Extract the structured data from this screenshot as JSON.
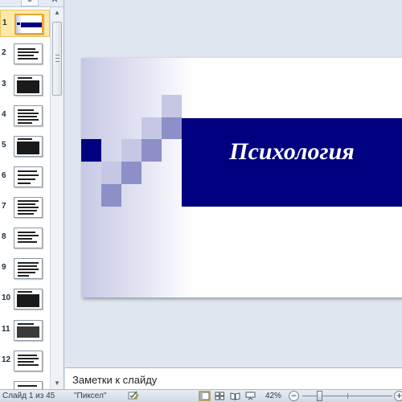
{
  "left_pane": {
    "tabs": {
      "outline": "",
      "slides": "≡",
      "close": "✕"
    },
    "thumbnails": [
      {
        "number": "1",
        "selected": true
      },
      {
        "number": "2"
      },
      {
        "number": "3"
      },
      {
        "number": "4"
      },
      {
        "number": "5"
      },
      {
        "number": "6"
      },
      {
        "number": "7"
      },
      {
        "number": "8"
      },
      {
        "number": "9"
      },
      {
        "number": "10"
      },
      {
        "number": "11"
      },
      {
        "number": "12"
      }
    ],
    "scroll_up": "▲",
    "scroll_down": "▼"
  },
  "slide": {
    "title": "Психология",
    "band_color": "#000080",
    "square_colors": [
      "#c6c7e4",
      "#8d8fc8",
      "#000080"
    ]
  },
  "notes": {
    "placeholder": "Заметки к слайду"
  },
  "status_bar": {
    "slide_info": "Слайд 1 из 45",
    "theme": "\"Пиксел\"",
    "zoom": "42%",
    "zoom_minus": "−",
    "zoom_plus": "+",
    "zoom_fraction": 0.2
  }
}
